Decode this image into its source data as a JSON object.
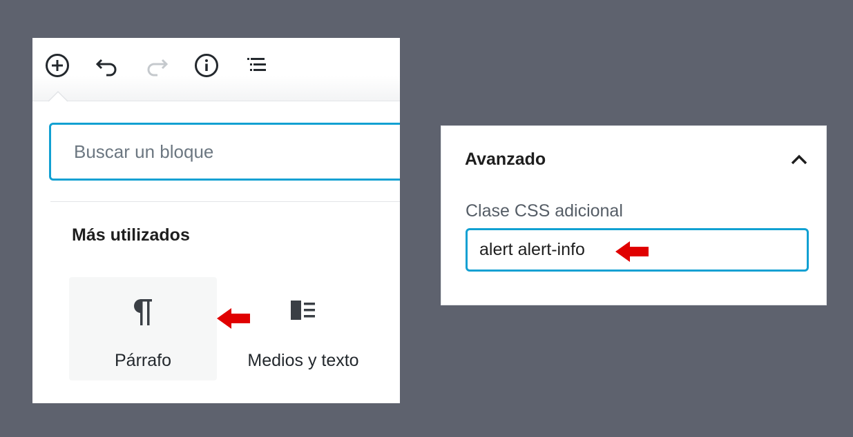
{
  "inserter": {
    "toolbar": {
      "add_icon": "plus-circle-icon",
      "undo_icon": "undo-icon",
      "redo_icon": "redo-icon",
      "info_icon": "info-icon",
      "outline_icon": "list-outline-icon"
    },
    "search": {
      "placeholder": "Buscar un bloque"
    },
    "section_title": "Más utilizados",
    "blocks": [
      {
        "label": "Párrafo",
        "icon": "paragraph-icon",
        "selected": true
      },
      {
        "label": "Medios y texto",
        "icon": "media-text-icon",
        "selected": false
      }
    ]
  },
  "advanced": {
    "title": "Avanzado",
    "toggle_icon": "chevron-up-icon",
    "css_class_label": "Clase CSS adicional",
    "css_class_value": "alert alert-info"
  },
  "colors": {
    "background": "#5e626e",
    "focus": "#11a0d2",
    "annotation_arrow": "#e00000",
    "text": "#1e1e1e"
  }
}
